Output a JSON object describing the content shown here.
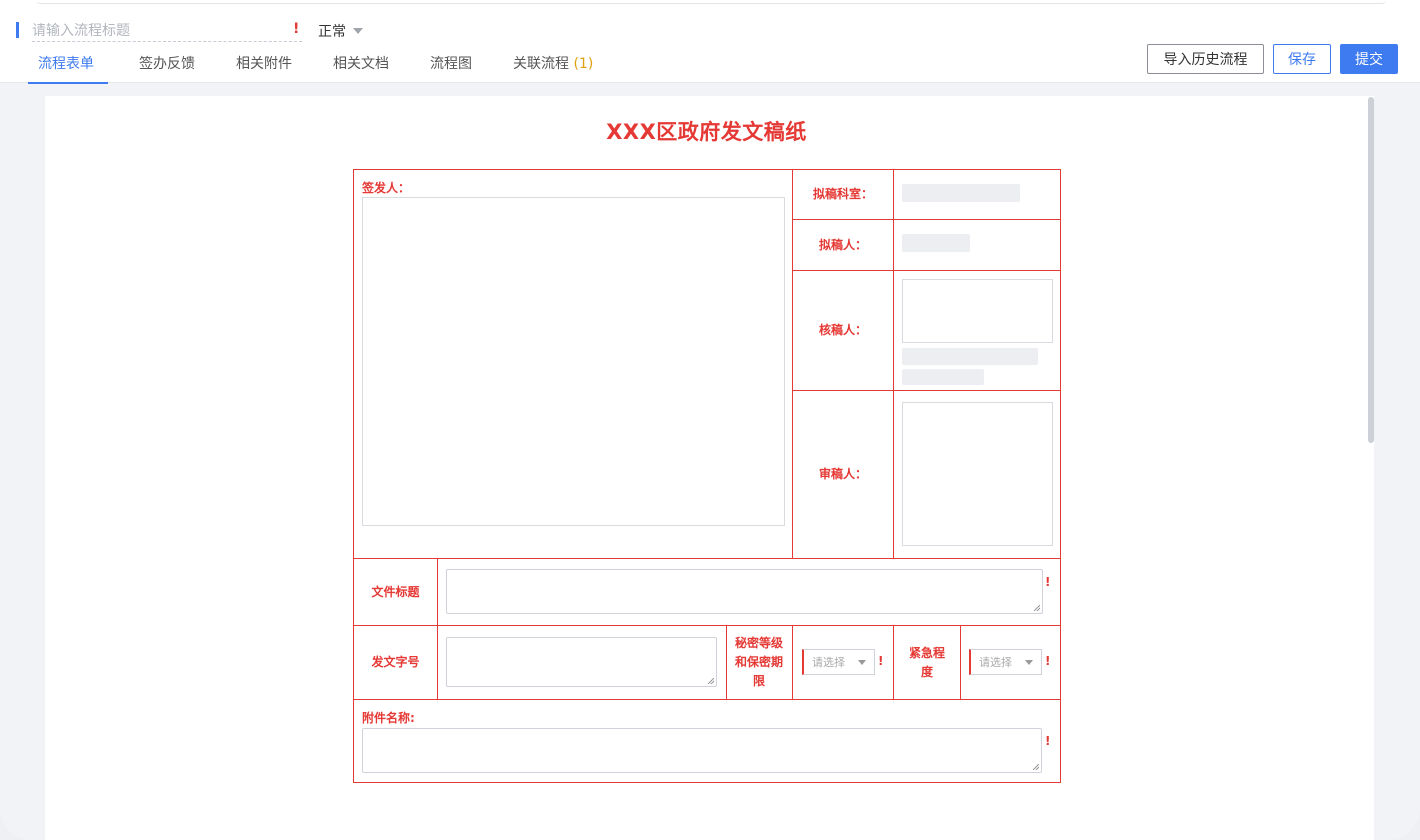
{
  "header": {
    "title_placeholder": "请输入流程标题",
    "required_mark": "!",
    "priority": "正常"
  },
  "tabs": [
    {
      "label": "流程表单",
      "active": true
    },
    {
      "label": "签办反馈"
    },
    {
      "label": "相关附件"
    },
    {
      "label": "相关文档"
    },
    {
      "label": "流程图"
    },
    {
      "label": "关联流程",
      "count": "(1)"
    }
  ],
  "toolbar": {
    "import_label": "导入历史流程",
    "save_label": "保存",
    "submit_label": "提交"
  },
  "form": {
    "title": "XXX区政府发文稿纸",
    "signer_label": "签发人：",
    "draft_dept_label": "拟稿科室：",
    "drafter_label": "拟稿人：",
    "checker_label": "核稿人：",
    "reviewer_label": "审稿人：",
    "doc_title_label": "文件标题",
    "doc_number_label": "发文字号",
    "secrecy_label": "秘密等级和保密期限",
    "secrecy_placeholder": "请选择",
    "urgency_label": "紧急程度",
    "urgency_placeholder": "请选择",
    "attachment_label": "附件名称:",
    "required_mark": "!"
  },
  "colors": {
    "accent": "#3f7bf0",
    "form_red": "#e53935",
    "count": "#e0a010"
  }
}
